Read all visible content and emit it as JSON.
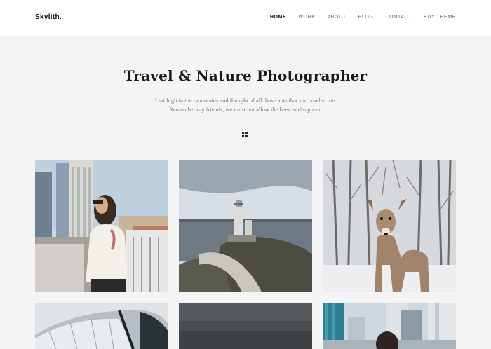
{
  "header": {
    "logo": "Skylith.",
    "nav": [
      {
        "label": "HOME",
        "active": true
      },
      {
        "label": "WORK",
        "active": false
      },
      {
        "label": "ABOUT",
        "active": false
      },
      {
        "label": "BLOG",
        "active": false
      },
      {
        "label": "CONTACT",
        "active": false
      },
      {
        "label": "BUY THEME",
        "active": false
      }
    ]
  },
  "hero": {
    "title": "Travel & Nature Photographer",
    "subtitle_line1": "I sat high in the mountains and thought of all those ants that surrounded me.",
    "subtitle_line2": "Remember my friends, we must not allow the bees to disappear."
  },
  "gallery": {
    "items": [
      {
        "subject": "woman-city-balcony-photo"
      },
      {
        "subject": "lighthouse-coast-photo"
      },
      {
        "subject": "deer-snow-forest-photo"
      },
      {
        "subject": "architecture-sail-photo"
      },
      {
        "subject": "dark-sky-photo"
      },
      {
        "subject": "woman-city-skyline-photo"
      }
    ]
  },
  "colors": {
    "background": "#f4f4f4",
    "header": "#ffffff",
    "text": "#1a1a1a",
    "muted": "#777777"
  },
  "icons": {
    "grid_toggle": "grid-icon"
  }
}
